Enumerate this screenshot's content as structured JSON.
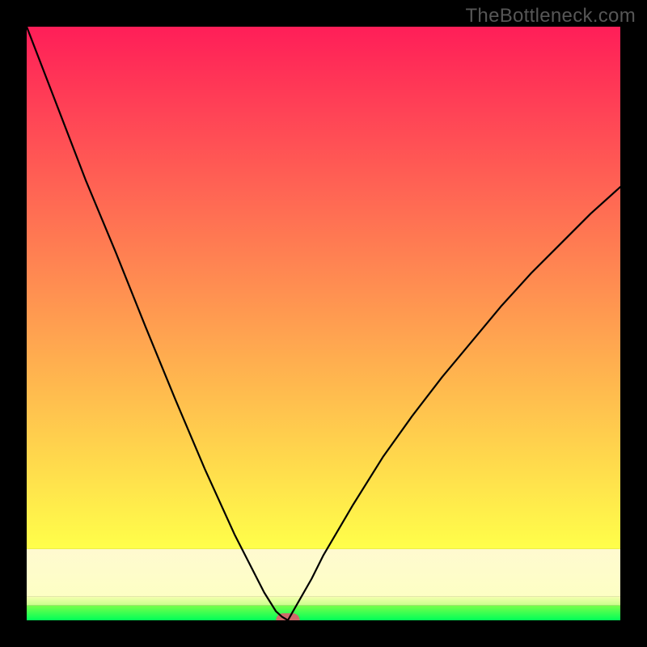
{
  "watermark": "TheBottleneck.com",
  "chart_data": {
    "type": "line",
    "title": "",
    "xlabel": "",
    "ylabel": "",
    "xlim": [
      0,
      100
    ],
    "ylim": [
      0,
      100
    ],
    "series": [
      {
        "name": "left-curve",
        "x": [
          0,
          5,
          10,
          15,
          20,
          25,
          30,
          35,
          40,
          42,
          43,
          44
        ],
        "values": [
          100,
          87,
          74,
          62,
          49.5,
          37.3,
          25.5,
          14.5,
          4.7,
          1.5,
          0.6,
          0
        ]
      },
      {
        "name": "right-curve",
        "x": [
          44,
          46,
          48,
          50,
          55,
          60,
          65,
          70,
          75,
          80,
          85,
          90,
          95,
          100
        ],
        "values": [
          0,
          3.5,
          7,
          11,
          19.5,
          27.5,
          34.5,
          41,
          47,
          53,
          58.5,
          63.5,
          68.5,
          73
        ]
      }
    ],
    "background_bands": [
      {
        "name": "green-band",
        "y0": 0.0,
        "y1": 2.5,
        "color0": "#00ff58",
        "color1": "#78ff4a"
      },
      {
        "name": "pale-band",
        "y0": 2.5,
        "y1": 4.0,
        "color0": "#c8ff8a",
        "color1": "#f5ffb0"
      },
      {
        "name": "cream-band",
        "y0": 4.0,
        "y1": 12.0,
        "color0": "#fdffc4",
        "color1": "#fffad0"
      },
      {
        "name": "main-gradient",
        "y0": 12.0,
        "y1": 100.0,
        "color0": "#ffff4a",
        "color1": "#ff1e58"
      }
    ],
    "marker": {
      "name": "min-marker",
      "x0": 42,
      "x1": 46,
      "y": 0,
      "半height": 1.2,
      "color": "#cf6a6a"
    }
  }
}
